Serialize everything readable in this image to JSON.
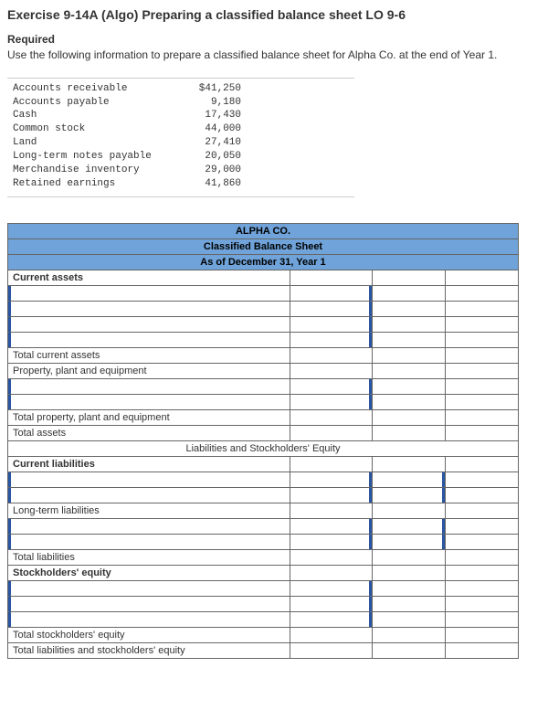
{
  "exercise_title": "Exercise 9-14A (Algo) Preparing a classified balance sheet LO 9-6",
  "required_label": "Required",
  "instructions": "Use the following information to prepare a classified balance sheet for Alpha Co. at the end of Year 1.",
  "data_items": [
    {
      "label": "Accounts receivable",
      "value": "$41,250"
    },
    {
      "label": "Accounts payable",
      "value": "9,180"
    },
    {
      "label": "Cash",
      "value": "17,430"
    },
    {
      "label": "Common stock",
      "value": "44,000"
    },
    {
      "label": "Land",
      "value": "27,410"
    },
    {
      "label": "Long-term notes payable",
      "value": "20,050"
    },
    {
      "label": "Merchandise inventory",
      "value": "29,000"
    },
    {
      "label": "Retained earnings",
      "value": "41,860"
    }
  ],
  "bs": {
    "company": "ALPHA CO.",
    "sheet_title": "Classified Balance Sheet",
    "as_of": "As of December 31, Year 1",
    "current_assets_label": "Current assets",
    "total_current_assets": "Total current assets",
    "ppe_label": "Property, plant and equipment",
    "total_ppe": "Total property, plant and equipment",
    "total_assets": "Total assets",
    "liab_equity_header": "Liabilities and Stockholders' Equity",
    "current_liabilities_label": "Current liabilities",
    "long_term_liabilities_label": "Long-term liabilities",
    "total_liabilities": "Total liabilities",
    "stockholders_equity_label": "Stockholders' equity",
    "total_stockholders_equity": "Total stockholders' equity",
    "total_liab_and_equity": "Total liabilities and stockholders' equity"
  }
}
